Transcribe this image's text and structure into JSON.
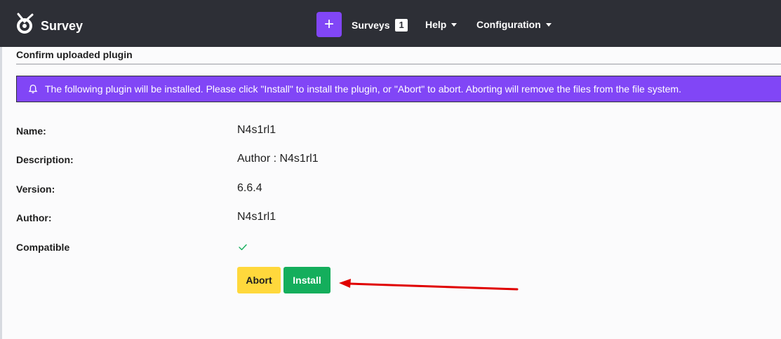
{
  "header": {
    "brand": "Survey",
    "nav": {
      "surveys_label": "Surveys",
      "surveys_count": "1",
      "help_label": "Help",
      "configuration_label": "Configuration"
    },
    "plus_icon": "plus-icon"
  },
  "page": {
    "title": "Confirm uploaded plugin",
    "alert": "The following plugin will be installed. Please click \"Install\" to install the plugin, or \"Abort\" to abort. Aborting will remove the files from the file system."
  },
  "details": [
    {
      "label": "Name:",
      "value": "N4s1rl1"
    },
    {
      "label": "Description:",
      "value": "Author : N4s1rl1"
    },
    {
      "label": "Version:",
      "value": "6.6.4"
    },
    {
      "label": "Author:",
      "value": "N4s1rl1"
    },
    {
      "label": "Compatible",
      "value_icon": "checkmark-icon"
    }
  ],
  "buttons": {
    "abort": "Abort",
    "install": "Install"
  },
  "colors": {
    "topbar": "#2d2f36",
    "accent": "#8146f6",
    "abort": "#ffd83c",
    "install": "#14ae5c",
    "annotation_arrow": "#e00000"
  }
}
